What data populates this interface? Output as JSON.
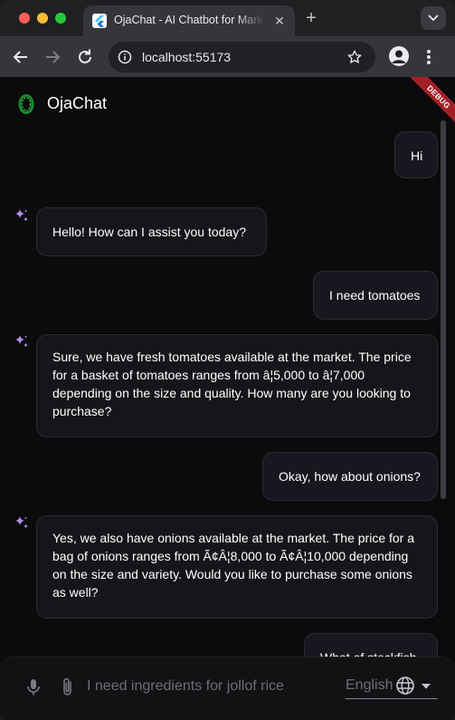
{
  "browser": {
    "tab_title": "OjaChat - AI Chatbot for Mark",
    "url": "localhost:55173"
  },
  "app": {
    "title": "OjaChat",
    "debug_label": "DEBUG"
  },
  "messages": [
    {
      "role": "user",
      "text": "Hi"
    },
    {
      "role": "bot",
      "text": "Hello! How can I assist you today?"
    },
    {
      "role": "user",
      "text": "I need tomatoes"
    },
    {
      "role": "bot",
      "text": "Sure, we have fresh tomatoes available at the market. The price for a basket of tomatoes ranges from â¦5,000 to â¦7,000 depending on the size and quality. How many are you looking to purchase?"
    },
    {
      "role": "user",
      "text": "Okay, how about onions?"
    },
    {
      "role": "bot",
      "text": "Yes, we also have onions available at the market. The price for a bag of onions ranges from Ã¢Â¦8,000 to Ã¢Â¦10,000 depending on the size and variety. Would you like to purchase some onions as well?"
    },
    {
      "role": "user",
      "text": "What of stockfish"
    }
  ],
  "composer": {
    "placeholder": "I need ingredients for jollof rice",
    "language": "English"
  },
  "colors": {
    "accent_sparkle": "#b78ce8",
    "debug_ribbon": "#a31f28",
    "user_bubble": "#19161f",
    "bot_bubble": "#161519"
  }
}
